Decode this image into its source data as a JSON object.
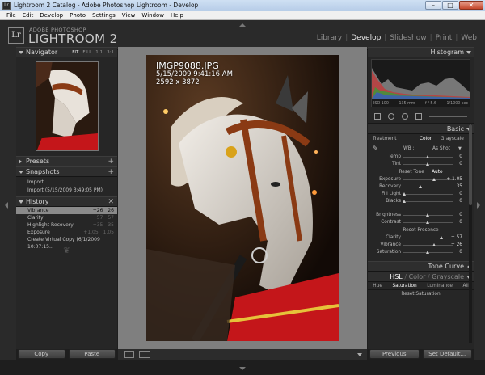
{
  "window": {
    "title": "Lightroom 2 Catalog - Adobe Photoshop Lightroom - Develop",
    "minimize": "–",
    "maximize": "□",
    "close": "✕"
  },
  "menubar": {
    "items": [
      "File",
      "Edit",
      "Develop",
      "Photo",
      "Settings",
      "View",
      "Window",
      "Help"
    ]
  },
  "identity": {
    "logo": "Lr",
    "sub": "ADOBE PHOTOSHOP",
    "name": "LIGHTROOM 2"
  },
  "modules": [
    "Library",
    "Develop",
    "Slideshow",
    "Print",
    "Web"
  ],
  "active_module": "Develop",
  "left": {
    "navigator": {
      "title": "Navigator",
      "zoom": [
        "FIT",
        "FILL",
        "1:1",
        "3:1"
      ]
    },
    "presets": {
      "title": "Presets",
      "add": "+"
    },
    "snapshots": {
      "title": "Snapshots",
      "add": "+",
      "items": [
        "Import",
        "Import (5/15/2009 3:49:05 PM)"
      ]
    },
    "history": {
      "title": "History",
      "clear": "✕",
      "items": [
        {
          "label": "Vibrance",
          "a": "+26",
          "b": "26",
          "selected": true
        },
        {
          "label": "Clarity",
          "a": "+57",
          "b": "57"
        },
        {
          "label": "Highlight Recovery",
          "a": "+35",
          "b": "35"
        },
        {
          "label": "Exposure",
          "a": "+1.05",
          "b": "1.05"
        },
        {
          "label": "Create Virtual Copy (6/1/2009 10:07:15...",
          "a": "",
          "b": ""
        }
      ]
    },
    "copy": "Copy",
    "paste": "Paste"
  },
  "photo": {
    "filename": "IMGP9088.JPG",
    "datetime": "5/15/2009 9:41:16 AM",
    "dimensions": "2592 x 3872"
  },
  "right": {
    "histogram": {
      "title": "Histogram",
      "iso": "ISO 100",
      "focal": "135 mm",
      "aperture": "f / 5.6",
      "shutter": "1/1000 sec"
    },
    "basic": {
      "title": "Basic",
      "treatment_label": "Treatment :",
      "color": "Color",
      "grayscale": "Grayscale",
      "wb_label": "WB :",
      "wb_value": "As Shot",
      "temp": {
        "label": "Temp",
        "value": "0",
        "pos": 0.5
      },
      "tint": {
        "label": "Tint",
        "value": "0",
        "pos": 0.5
      },
      "tone_label": "Reset Tone",
      "auto": "Auto",
      "exposure": {
        "label": "Exposure",
        "value": "+ 1.05",
        "pos": 0.63
      },
      "recovery": {
        "label": "Recovery",
        "value": "35",
        "pos": 0.35
      },
      "fill": {
        "label": "Fill Light",
        "value": "0",
        "pos": 0.02
      },
      "blacks": {
        "label": "Blacks",
        "value": "0",
        "pos": 0.02
      },
      "brightness": {
        "label": "Brightness",
        "value": "0",
        "pos": 0.5
      },
      "contrast": {
        "label": "Contrast",
        "value": "0",
        "pos": 0.5
      },
      "presence_label": "Reset Presence",
      "clarity": {
        "label": "Clarity",
        "value": "+ 57",
        "pos": 0.78
      },
      "vibrance": {
        "label": "Vibrance",
        "value": "+ 26",
        "pos": 0.63
      },
      "saturation": {
        "label": "Saturation",
        "value": "0",
        "pos": 0.5
      }
    },
    "tone_curve": {
      "title": "Tone Curve"
    },
    "hsl": {
      "title_parts": [
        "HSL",
        "Color",
        "Grayscale"
      ],
      "tabs": [
        "Hue",
        "Saturation",
        "Luminance",
        "All"
      ],
      "reset": "Reset Saturation"
    },
    "previous": "Previous",
    "set_default": "Set Default..."
  },
  "colors": {
    "accent_active": "#e6e6e6",
    "panel_bg": "#262626",
    "selected_row": "#8a8a8a"
  }
}
